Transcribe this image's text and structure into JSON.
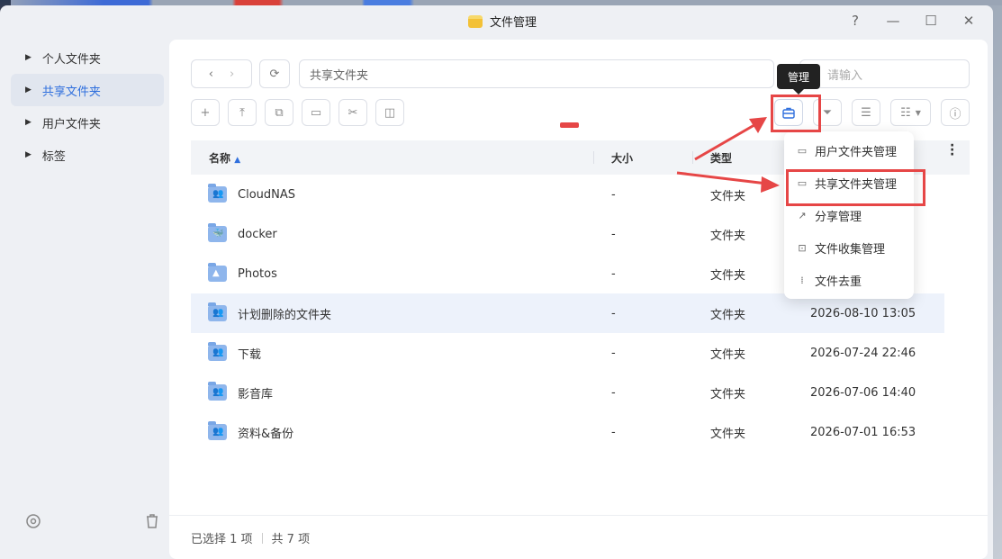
{
  "window": {
    "title": "文件管理",
    "help": "?",
    "minimize": "—",
    "maximize": "☐",
    "close": "✕"
  },
  "sidebar": {
    "items": [
      {
        "label": "个人文件夹"
      },
      {
        "label": "共享文件夹"
      },
      {
        "label": "用户文件夹"
      },
      {
        "label": "标签"
      }
    ]
  },
  "path": {
    "value": "共享文件夹"
  },
  "search": {
    "placeholder": "请输入"
  },
  "tooltip": "管理",
  "table": {
    "headers": {
      "name": "名称",
      "size": "大小",
      "type": "类型"
    },
    "rows": [
      {
        "name": "CloudNAS",
        "size": "-",
        "type": "文件夹",
        "date": ""
      },
      {
        "name": "docker",
        "size": "-",
        "type": "文件夹",
        "date": ""
      },
      {
        "name": "Photos",
        "size": "-",
        "type": "文件夹",
        "date": ""
      },
      {
        "name": "计划删除的文件夹",
        "size": "-",
        "type": "文件夹",
        "date": "2026-08-10 13:05"
      },
      {
        "name": "下载",
        "size": "-",
        "type": "文件夹",
        "date": "2026-07-24 22:46"
      },
      {
        "name": "影音库",
        "size": "-",
        "type": "文件夹",
        "date": "2026-07-06 14:40"
      },
      {
        "name": "资料&备份",
        "size": "-",
        "type": "文件夹",
        "date": "2026-07-01 16:53"
      }
    ]
  },
  "menu": {
    "items": [
      {
        "label": "用户文件夹管理"
      },
      {
        "label": "共享文件夹管理"
      },
      {
        "label": "分享管理"
      },
      {
        "label": "文件收集管理"
      },
      {
        "label": "文件去重"
      }
    ]
  },
  "footer": {
    "selected": "已选择 1 项",
    "total": "共 7 项"
  },
  "colors": {
    "accent": "#2f6fdd",
    "annotation": "#e64646",
    "folder": "#8fb6ec"
  }
}
